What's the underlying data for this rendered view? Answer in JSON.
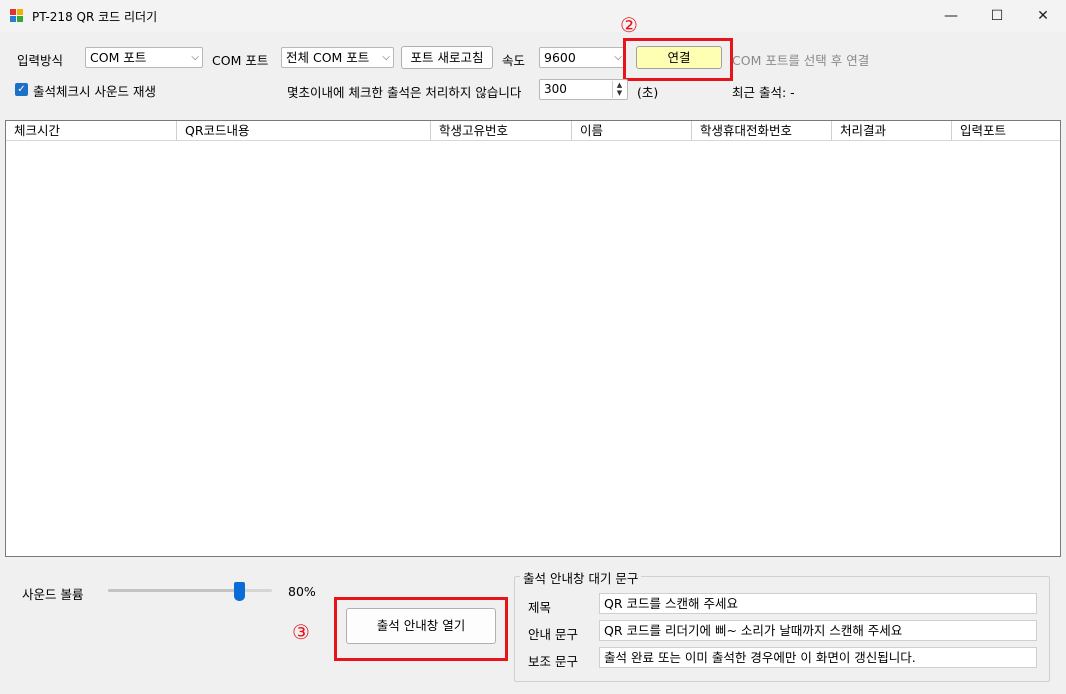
{
  "window": {
    "title": "PT-218 QR 코드 리더기",
    "controls": {
      "minimize": "—",
      "maximize": "☐",
      "close": "✕"
    }
  },
  "toolbar": {
    "input_method_label": "입력방식",
    "input_method_value": "COM 포트",
    "com_port_label": "COM 포트",
    "com_port_value": "전체 COM 포트",
    "refresh_button": "포트 새로고침",
    "speed_label": "속도",
    "speed_value": "9600",
    "connect_button": "연결",
    "status_text": "COM 포트를 선택 후 연결",
    "sound_checkbox_label": "출석체크시 사운드 재생",
    "sound_checked": true,
    "ignore_label": "몇초이내에 체크한 출석은 처리하지 않습니다",
    "ignore_seconds": "300",
    "seconds_unit": "(초)",
    "recent_label": "최근 출석: -"
  },
  "grid": {
    "columns": [
      "체크시간",
      "QR코드내용",
      "학생고유번호",
      "이름",
      "학생휴대전화번호",
      "처리결과",
      "입력포트"
    ],
    "rows": []
  },
  "bottom": {
    "volume_label": "사운드 볼륨",
    "volume_percent": 80,
    "volume_text": "80%",
    "open_button": "출석 안내창 열기",
    "group_title": "출석 안내창 대기 문구",
    "title_label": "제목",
    "title_value": "QR 코드를 스캔해 주세요",
    "guide_label": "안내 문구",
    "guide_value": "QR 코드를 리더기에 삐~ 소리가 날때까지 스캔해 주세요",
    "aux_label": "보조 문구",
    "aux_value": "출석 완료 또는 이미 출석한 경우에만 이 화면이 갱신됩니다."
  },
  "annotations": {
    "marker_2": "②",
    "marker_3": "③"
  },
  "colors": {
    "highlight": "#e8141c",
    "connect_bg": "#ffffb3",
    "accent": "#0a6cd6"
  }
}
